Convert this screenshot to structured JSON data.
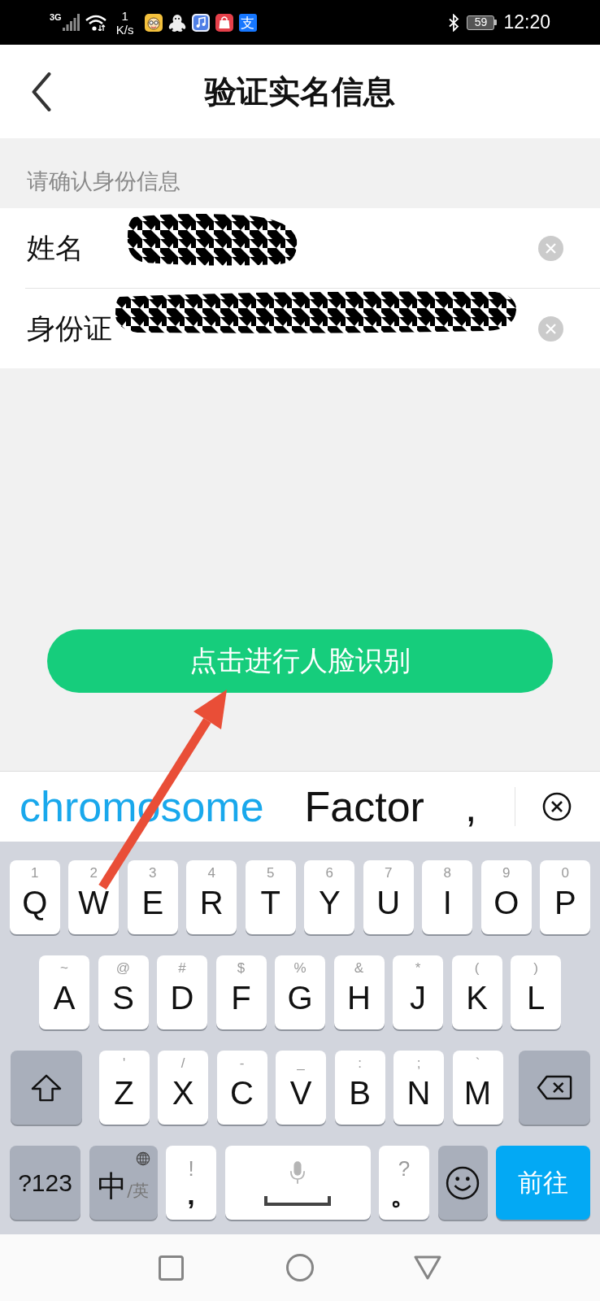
{
  "status_bar": {
    "network_type": "3G",
    "speed_value": "1",
    "speed_unit": "K/s",
    "notification_icons": [
      {
        "kind": "face"
      },
      {
        "kind": "penguin"
      },
      {
        "kind": "music"
      },
      {
        "kind": "shop"
      },
      {
        "kind": "glyph",
        "glyph": "支"
      }
    ],
    "battery": "59",
    "time": "12:20"
  },
  "header": {
    "title": "验证实名信息"
  },
  "section_label": "请确认身份信息",
  "fields": [
    {
      "label": "姓名",
      "redacted": true
    },
    {
      "label": "身份证",
      "redacted": true
    }
  ],
  "action_button": {
    "label": "点击进行人脸识别"
  },
  "suggestions": [
    {
      "text": "chromosome",
      "selected": true
    },
    {
      "text": "Factor",
      "selected": false
    },
    {
      "text": ",",
      "selected": false
    }
  ],
  "keyboard": {
    "rows": [
      [
        {
          "kind": "letter",
          "hint": "1",
          "label": "Q"
        },
        {
          "kind": "letter",
          "hint": "2",
          "label": "W"
        },
        {
          "kind": "letter",
          "hint": "3",
          "label": "E"
        },
        {
          "kind": "letter",
          "hint": "4",
          "label": "R"
        },
        {
          "kind": "letter",
          "hint": "5",
          "label": "T"
        },
        {
          "kind": "letter",
          "hint": "6",
          "label": "Y"
        },
        {
          "kind": "letter",
          "hint": "7",
          "label": "U"
        },
        {
          "kind": "letter",
          "hint": "8",
          "label": "I"
        },
        {
          "kind": "letter",
          "hint": "9",
          "label": "O"
        },
        {
          "kind": "letter",
          "hint": "0",
          "label": "P"
        }
      ],
      [
        {
          "kind": "letter",
          "hint": "~",
          "label": "A"
        },
        {
          "kind": "letter",
          "hint": "@",
          "label": "S"
        },
        {
          "kind": "letter",
          "hint": "#",
          "label": "D"
        },
        {
          "kind": "letter",
          "hint": "$",
          "label": "F"
        },
        {
          "kind": "letter",
          "hint": "%",
          "label": "G"
        },
        {
          "kind": "letter",
          "hint": "&",
          "label": "H"
        },
        {
          "kind": "letter",
          "hint": "*",
          "label": "J"
        },
        {
          "kind": "letter",
          "hint": "(",
          "label": "K"
        },
        {
          "kind": "letter",
          "hint": ")",
          "label": "L"
        }
      ],
      [
        {
          "kind": "shift"
        },
        {
          "kind": "letter",
          "hint": "'",
          "label": "Z"
        },
        {
          "kind": "letter",
          "hint": "/",
          "label": "X"
        },
        {
          "kind": "letter",
          "hint": "-",
          "label": "C"
        },
        {
          "kind": "letter",
          "hint": "_",
          "label": "V"
        },
        {
          "kind": "letter",
          "hint": ":",
          "label": "B"
        },
        {
          "kind": "letter",
          "hint": ";",
          "label": "N"
        },
        {
          "kind": "letter",
          "hint": "`",
          "label": "M"
        },
        {
          "kind": "backspace"
        }
      ],
      [
        {
          "kind": "symbols",
          "label": "?123"
        },
        {
          "kind": "lang",
          "label": "中",
          "sub": "/英"
        },
        {
          "kind": "punct",
          "hint": "!",
          "label": ","
        },
        {
          "kind": "space"
        },
        {
          "kind": "punct",
          "hint": "?",
          "label": "。"
        },
        {
          "kind": "emoji"
        },
        {
          "kind": "go",
          "label": "前往"
        }
      ]
    ]
  }
}
